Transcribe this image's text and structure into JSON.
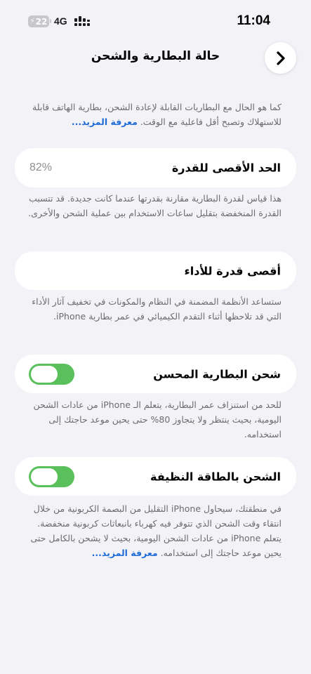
{
  "status_bar": {
    "battery": "22",
    "network": "4G",
    "time": "11:04"
  },
  "nav": {
    "title": "حالة البطارية والشحن"
  },
  "intro": {
    "text": "كما هو الحال مع البطاريات القابلة لإعادة الشحن، بطارية الهاتف قابلة للاستهلاك وتصبح أقل فاعلية مع الوقت.",
    "link": "معرفة المزيد..."
  },
  "maximum_capacity": {
    "label": "الحد الأقصى للقدرة",
    "value": "82%",
    "description": "هذا قياس لقدرة البطارية مقارنة بقدرتها عندما كانت جديدة. قد تتسبب القدرة المنخفضة بتقليل ساعات الاستخدام بين عملية الشحن والأخرى."
  },
  "peak_performance": {
    "label": "أقصى قدرة للأداء",
    "description": "ستساعد الأنظمة المضمنة في النظام والمكونات في تخفيف آثار الأداء التي قد تلاحظها أثناء التقدم الكيميائي في عمر بطارية iPhone."
  },
  "optimized_charging": {
    "label": "شحن البطارية المحسن",
    "enabled": true,
    "description": "للحد من استنزاف عمر البطارية، يتعلم الـ iPhone من عادات الشحن اليومية، بحيث ينتظر ولا يتجاوز 80% حتى يحين موعد حاجتك إلى استخدامه."
  },
  "clean_energy": {
    "label": "الشحن بالطاقة النظيفة",
    "enabled": true,
    "description": "في منطقتك، سيحاول iPhone التقليل من البصمة الكربونية من خلال انتقاء وقت الشحن الذي تتوفر فيه كهرباء بانبعاثات كربونية منخفضة. يتعلم iPhone من عادات الشحن اليومية، بحيث لا يشحن بالكامل حتى يحين موعد حاجتك إلى استخدامه.",
    "link": "معرفة المزيد..."
  },
  "colors": {
    "background": "#f2f2f7",
    "toggle_on": "#5ac05b",
    "link": "#1f6bd6"
  },
  "icons": [
    "battery-icon",
    "signal-icon",
    "chevron-right-icon"
  ]
}
